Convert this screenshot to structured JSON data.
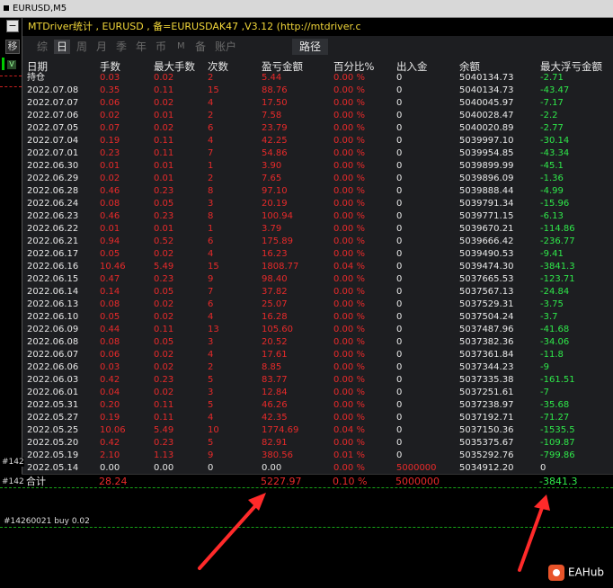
{
  "chart_window": {
    "title": "EURUSD,M5"
  },
  "side": {
    "btn_minus": "−",
    "btn_yi": "移",
    "v_mark": "V"
  },
  "panel": {
    "title": "MTDriver统计 , EURUSD , 备=EURUSDAK47 ,V3.12 (http://mtdriver.c",
    "tabs": [
      {
        "label": "综",
        "active": false
      },
      {
        "label": "日",
        "active": true
      },
      {
        "label": "周",
        "active": false
      },
      {
        "label": "月",
        "active": false
      },
      {
        "label": "季",
        "active": false
      },
      {
        "label": "年",
        "active": false
      },
      {
        "label": "币",
        "active": false
      },
      {
        "label": "M",
        "active": false
      },
      {
        "label": "备",
        "active": false
      },
      {
        "label": "账户",
        "active": false
      }
    ],
    "route_tab": "路径",
    "columns": [
      "日期",
      "手数",
      "最大手数",
      "次数",
      "盈亏金额",
      "百分比%",
      "出入金",
      "余额",
      "最大浮亏金额"
    ],
    "rows": [
      [
        "持仓",
        "0.03",
        "0.02",
        "2",
        "5.44",
        "0.00 %",
        "0",
        "5040134.73",
        "-2.71"
      ],
      [
        "2022.07.08",
        "0.35",
        "0.11",
        "15",
        "88.76",
        "0.00 %",
        "0",
        "5040134.73",
        "-43.47"
      ],
      [
        "2022.07.07",
        "0.06",
        "0.02",
        "4",
        "17.50",
        "0.00 %",
        "0",
        "5040045.97",
        "-7.17"
      ],
      [
        "2022.07.06",
        "0.02",
        "0.01",
        "2",
        "7.58",
        "0.00 %",
        "0",
        "5040028.47",
        "-2.2"
      ],
      [
        "2022.07.05",
        "0.07",
        "0.02",
        "6",
        "23.79",
        "0.00 %",
        "0",
        "5040020.89",
        "-2.77"
      ],
      [
        "2022.07.04",
        "0.19",
        "0.11",
        "4",
        "42.25",
        "0.00 %",
        "0",
        "5039997.10",
        "-30.14"
      ],
      [
        "2022.07.01",
        "0.23",
        "0.11",
        "7",
        "54.86",
        "0.00 %",
        "0",
        "5039954.85",
        "-43.34"
      ],
      [
        "2022.06.30",
        "0.01",
        "0.01",
        "1",
        "3.90",
        "0.00 %",
        "0",
        "5039899.99",
        "-45.1"
      ],
      [
        "2022.06.29",
        "0.02",
        "0.01",
        "2",
        "7.65",
        "0.00 %",
        "0",
        "5039896.09",
        "-1.36"
      ],
      [
        "2022.06.28",
        "0.46",
        "0.23",
        "8",
        "97.10",
        "0.00 %",
        "0",
        "5039888.44",
        "-4.99"
      ],
      [
        "2022.06.24",
        "0.08",
        "0.05",
        "3",
        "20.19",
        "0.00 %",
        "0",
        "5039791.34",
        "-15.96"
      ],
      [
        "2022.06.23",
        "0.46",
        "0.23",
        "8",
        "100.94",
        "0.00 %",
        "0",
        "5039771.15",
        "-6.13"
      ],
      [
        "2022.06.22",
        "0.01",
        "0.01",
        "1",
        "3.79",
        "0.00 %",
        "0",
        "5039670.21",
        "-114.86"
      ],
      [
        "2022.06.21",
        "0.94",
        "0.52",
        "6",
        "175.89",
        "0.00 %",
        "0",
        "5039666.42",
        "-236.77"
      ],
      [
        "2022.06.17",
        "0.05",
        "0.02",
        "4",
        "16.23",
        "0.00 %",
        "0",
        "5039490.53",
        "-9.41"
      ],
      [
        "2022.06.16",
        "10.46",
        "5.49",
        "15",
        "1808.77",
        "0.04 %",
        "0",
        "5039474.30",
        "-3841.3"
      ],
      [
        "2022.06.15",
        "0.47",
        "0.23",
        "9",
        "98.40",
        "0.00 %",
        "0",
        "5037665.53",
        "-123.71"
      ],
      [
        "2022.06.14",
        "0.14",
        "0.05",
        "7",
        "37.82",
        "0.00 %",
        "0",
        "5037567.13",
        "-24.84"
      ],
      [
        "2022.06.13",
        "0.08",
        "0.02",
        "6",
        "25.07",
        "0.00 %",
        "0",
        "5037529.31",
        "-3.75"
      ],
      [
        "2022.06.10",
        "0.05",
        "0.02",
        "4",
        "16.28",
        "0.00 %",
        "0",
        "5037504.24",
        "-3.7"
      ],
      [
        "2022.06.09",
        "0.44",
        "0.11",
        "13",
        "105.60",
        "0.00 %",
        "0",
        "5037487.96",
        "-41.68"
      ],
      [
        "2022.06.08",
        "0.08",
        "0.05",
        "3",
        "20.52",
        "0.00 %",
        "0",
        "5037382.36",
        "-34.06"
      ],
      [
        "2022.06.07",
        "0.06",
        "0.02",
        "4",
        "17.61",
        "0.00 %",
        "0",
        "5037361.84",
        "-11.8"
      ],
      [
        "2022.06.06",
        "0.03",
        "0.02",
        "2",
        "8.85",
        "0.00 %",
        "0",
        "5037344.23",
        "-9"
      ],
      [
        "2022.06.03",
        "0.42",
        "0.23",
        "5",
        "83.77",
        "0.00 %",
        "0",
        "5037335.38",
        "-161.51"
      ],
      [
        "2022.06.01",
        "0.04",
        "0.02",
        "3",
        "12.84",
        "0.00 %",
        "0",
        "5037251.61",
        "-7"
      ],
      [
        "2022.05.31",
        "0.20",
        "0.11",
        "5",
        "46.26",
        "0.00 %",
        "0",
        "5037238.97",
        "-35.68"
      ],
      [
        "2022.05.27",
        "0.19",
        "0.11",
        "4",
        "42.35",
        "0.00 %",
        "0",
        "5037192.71",
        "-71.27"
      ],
      [
        "2022.05.25",
        "10.06",
        "5.49",
        "10",
        "1774.69",
        "0.04 %",
        "0",
        "5037150.36",
        "-1535.5"
      ],
      [
        "2022.05.20",
        "0.42",
        "0.23",
        "5",
        "82.91",
        "0.00 %",
        "0",
        "5035375.67",
        "-109.87"
      ],
      [
        "2022.05.19",
        "2.10",
        "1.13",
        "9",
        "380.56",
        "0.01 %",
        "0",
        "5035292.76",
        "-799.86"
      ],
      [
        "2022.05.14",
        "0.00",
        "0.00",
        "0",
        "0.00",
        "0.00 %",
        "5000000",
        "5034912.20",
        "0"
      ]
    ],
    "total": [
      "合计",
      "28.24",
      "",
      "",
      "5227.97",
      "0.10 %",
      "5000000",
      "",
      "-3841.3"
    ]
  },
  "order_labels": {
    "a": "#142",
    "b": "#142",
    "c": "#14260021 buy 0.02"
  },
  "watermark": {
    "text": "EAHub"
  }
}
